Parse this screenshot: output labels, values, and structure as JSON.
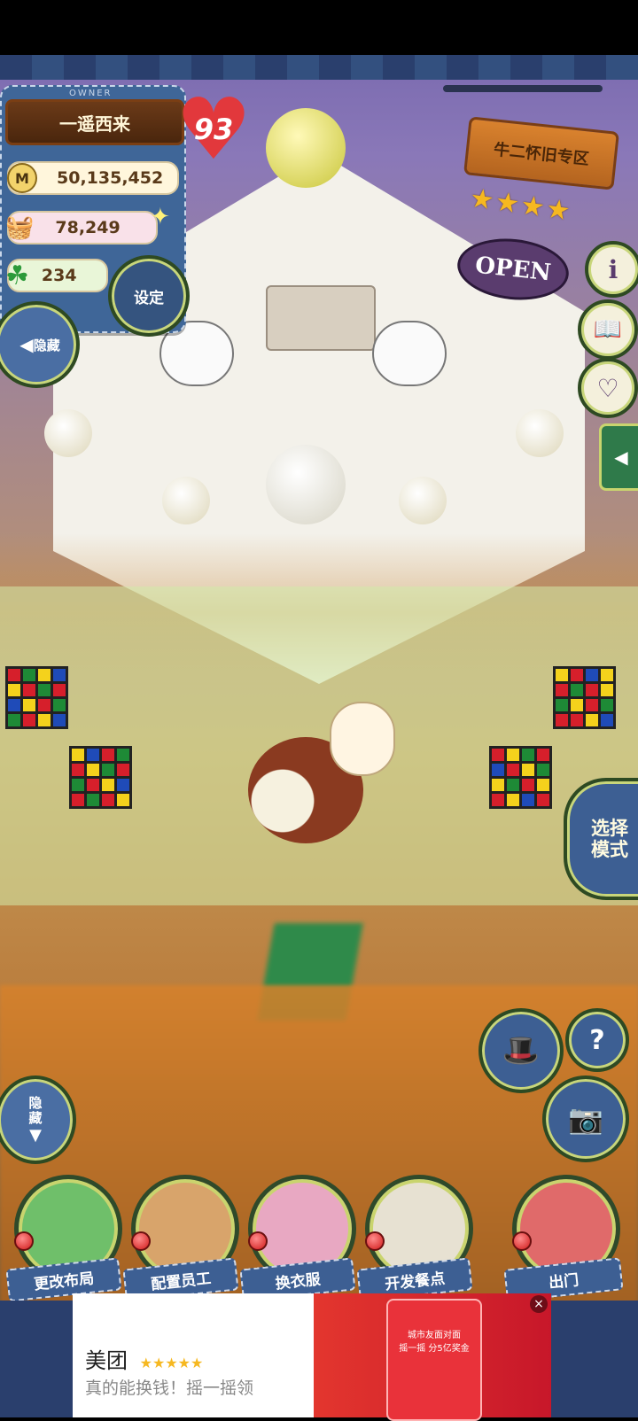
{
  "owner": {
    "badge": "OWNER",
    "name": "一遥西来",
    "level": "93"
  },
  "stats": {
    "money": "50,135,452",
    "food": "78,249",
    "clover": "234"
  },
  "settings_label": "设定",
  "hide_top_label": "隐藏",
  "hide_bottom_label": "隐藏",
  "shop": {
    "name": "牛二怀旧专区",
    "stars": "★★★★",
    "status": "OPEN"
  },
  "select_mode_label": "选择模式",
  "bottom_menu": [
    {
      "label": "更改布局"
    },
    {
      "label": "配置员工"
    },
    {
      "label": "换衣服"
    },
    {
      "label": "开发餐点"
    },
    {
      "label": "出门"
    }
  ],
  "ad": {
    "brand": "美团",
    "stars": "★★★★★",
    "text": "真的能换钱！摇一摇领",
    "promo_line1": "城市友面对面",
    "promo_line2": "摇一摇 分5亿奖金"
  },
  "colors": {
    "accent_red": "#e2383c",
    "denim": "#3f6698",
    "wood": "#d9822e"
  }
}
